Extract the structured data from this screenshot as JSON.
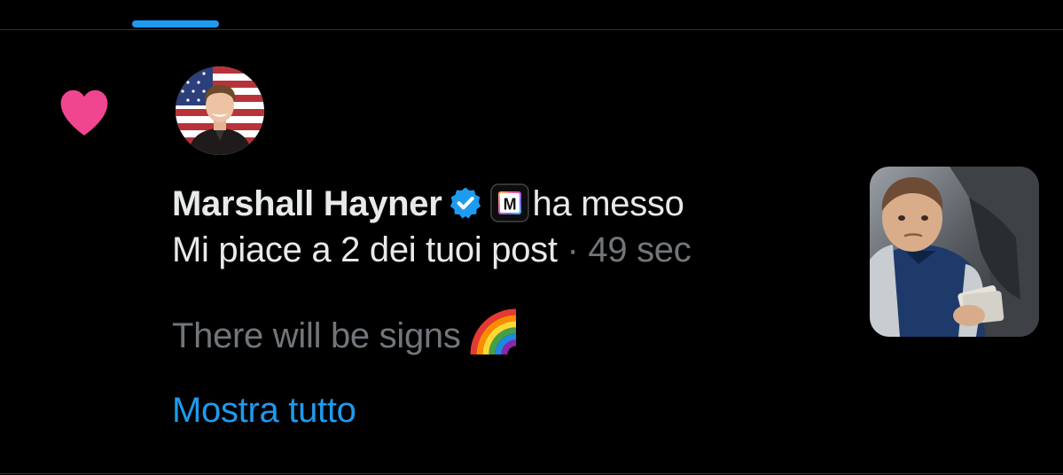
{
  "notification": {
    "user_name": "Marshall Hayner",
    "action_line1": "ha messo",
    "action_line2": "Mi piace a 2 dei tuoi post",
    "separator": "·",
    "timestamp": "49 sec",
    "affiliate_badge_letter": "M",
    "post_preview": "There will be signs",
    "show_all_label": "Mostra tutto",
    "icon": "heart-icon",
    "verified_icon": "verified-badge-icon"
  },
  "colors": {
    "background": "#000000",
    "primary_text": "#e7e9ea",
    "secondary_text": "#71767b",
    "accent": "#1d9bf0",
    "like_heart": "#f91880"
  }
}
